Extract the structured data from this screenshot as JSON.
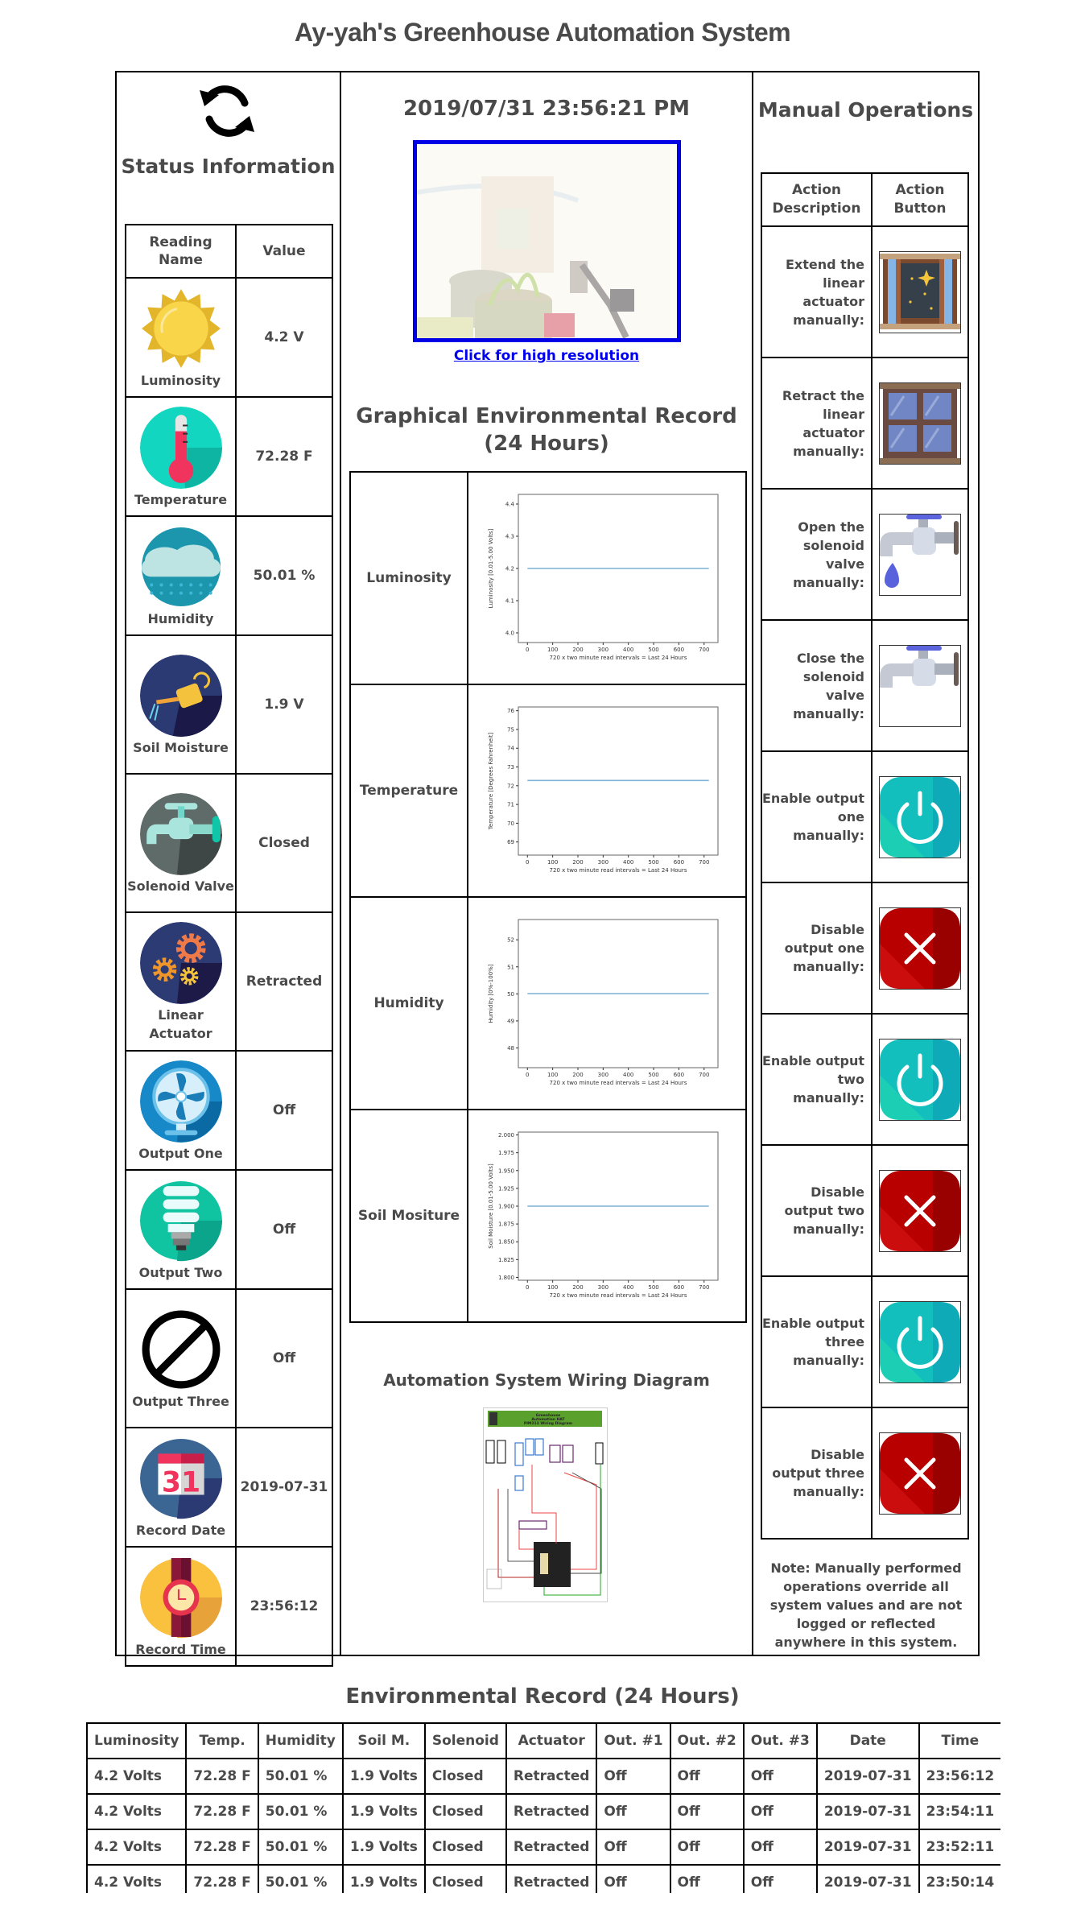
{
  "page": {
    "title": "Ay-yah's Greenhouse Automation System"
  },
  "status": {
    "heading": "Status Information",
    "refresh_icon": "refresh-icon",
    "columns": [
      "Reading Name",
      "Value"
    ],
    "rows": [
      {
        "label": "Luminosity",
        "value": "4.2 V",
        "icon": "sun-icon"
      },
      {
        "label": "Temperature",
        "value": "72.28 F",
        "icon": "thermometer-icon"
      },
      {
        "label": "Humidity",
        "value": "50.01 %",
        "icon": "rain-cloud-icon"
      },
      {
        "label": "Soil Moisture",
        "value": "1.9 V",
        "icon": "watering-can-icon"
      },
      {
        "label": "Solenoid Valve",
        "value": "Closed",
        "icon": "faucet-icon"
      },
      {
        "label": "Linear Actuator",
        "value": "Retracted",
        "icon": "gears-icon"
      },
      {
        "label": "Output One",
        "value": "Off",
        "icon": "fan-icon"
      },
      {
        "label": "Output Two",
        "value": "Off",
        "icon": "light-bulb-icon"
      },
      {
        "label": "Output Three",
        "value": "Off",
        "icon": "prohibited-icon"
      },
      {
        "label": "Record Date",
        "value": "2019-07-31",
        "icon": "calendar-icon"
      },
      {
        "label": "Record Time",
        "value": "23:56:12",
        "icon": "wristwatch-icon"
      }
    ]
  },
  "center": {
    "clock": "2019/07/31 23:56:21 PM",
    "camera_link": "Click for high resolution",
    "graph_heading": "Graphical Environmental Record (24 Hours)",
    "wiring_heading": "Automation System Wiring Diagram",
    "wiring_title_lines": [
      "Greenhouse",
      "Automation HAT",
      "PIM213 Wiring Diagram"
    ]
  },
  "chart_data": [
    {
      "type": "line",
      "row_label": "Luminosity",
      "ylabel": "Luminosity [0.01-5.00 Volts]",
      "xlabel": "720 x two minute read intervals = Last 24 Hours",
      "xlim": [
        -36,
        755
      ],
      "ylim": [
        3.97,
        4.43
      ],
      "xticks": [
        0,
        100,
        200,
        300,
        400,
        500,
        600,
        700
      ],
      "yticks": [
        "4.0",
        "4.1",
        "4.2",
        "4.3",
        "4.4"
      ],
      "x": [
        0,
        719
      ],
      "y": [
        4.2,
        4.2
      ]
    },
    {
      "type": "line",
      "row_label": "Temperature",
      "ylabel": "Temperature [Degrees Fahrenheit]",
      "xlabel": "720 x two minute read intervals = Last 24 Hours",
      "xlim": [
        -36,
        755
      ],
      "ylim": [
        68.3,
        76.2
      ],
      "xticks": [
        0,
        100,
        200,
        300,
        400,
        500,
        600,
        700
      ],
      "yticks": [
        "69",
        "70",
        "71",
        "72",
        "73",
        "74",
        "75",
        "76"
      ],
      "x": [
        0,
        719
      ],
      "y": [
        72.28,
        72.28
      ]
    },
    {
      "type": "line",
      "row_label": "Humidity",
      "ylabel": "Humidity [0%-100%]",
      "xlabel": "720 x two minute read intervals = Last 24 Hours",
      "xlim": [
        -36,
        755
      ],
      "ylim": [
        47.27,
        52.75
      ],
      "xticks": [
        0,
        100,
        200,
        300,
        400,
        500,
        600,
        700
      ],
      "yticks": [
        "48",
        "49",
        "50",
        "51",
        "52"
      ],
      "x": [
        0,
        719
      ],
      "y": [
        50.01,
        50.01
      ]
    },
    {
      "type": "line",
      "row_label": "Soil Mositure",
      "ylabel": "Soil Moisture [0.01-5.00 Volts]",
      "xlabel": "720 x two minute read intervals = Last 24 Hours",
      "xlim": [
        -36,
        755
      ],
      "ylim": [
        1.796,
        2.004
      ],
      "xticks": [
        0,
        100,
        200,
        300,
        400,
        500,
        600,
        700
      ],
      "yticks": [
        "1.800",
        "1.825",
        "1.850",
        "1.875",
        "1.900",
        "1.925",
        "1.950",
        "1.975",
        "2.000"
      ],
      "x": [
        0,
        719
      ],
      "y": [
        1.9,
        1.9
      ]
    }
  ],
  "manual": {
    "heading": "Manual Operations",
    "columns": [
      "Action Description",
      "Action Button"
    ],
    "actions": [
      {
        "label": "Extend the linear actuator manually:",
        "icon": "open-window-icon"
      },
      {
        "label": "Retract the linear actuator manually:",
        "icon": "closed-window-icon"
      },
      {
        "label": "Open the solenoid valve manually:",
        "icon": "faucet-dripping-icon"
      },
      {
        "label": "Close the solenoid valve manually:",
        "icon": "faucet-icon"
      },
      {
        "label": "Enable output one manually:",
        "icon": "power-on-icon"
      },
      {
        "label": "Disable output one manually:",
        "icon": "power-off-icon"
      },
      {
        "label": "Enable output two manually:",
        "icon": "power-on-icon"
      },
      {
        "label": "Disable output two manually:",
        "icon": "power-off-icon"
      },
      {
        "label": "Enable output three manually:",
        "icon": "power-on-icon"
      },
      {
        "label": "Disable output three manually:",
        "icon": "power-off-icon"
      }
    ],
    "note": "Note: Manually performed operations override all system values and are not logged or reflected anywhere in this system."
  },
  "record": {
    "heading": "Environmental Record (24 Hours)",
    "columns": [
      "Luminosity",
      "Temp.",
      "Humidity",
      "Soil M.",
      "Solenoid",
      "Actuator",
      "Out. #1",
      "Out. #2",
      "Out. #3",
      "Date",
      "Time"
    ],
    "rows": [
      [
        "4.2 Volts",
        "72.28 F",
        "50.01 %",
        "1.9 Volts",
        "Closed",
        "Retracted",
        "Off",
        "Off",
        "Off",
        "2019-07-31",
        "23:56:12"
      ],
      [
        "4.2 Volts",
        "72.28 F",
        "50.01 %",
        "1.9 Volts",
        "Closed",
        "Retracted",
        "Off",
        "Off",
        "Off",
        "2019-07-31",
        "23:54:11"
      ],
      [
        "4.2 Volts",
        "72.28 F",
        "50.01 %",
        "1.9 Volts",
        "Closed",
        "Retracted",
        "Off",
        "Off",
        "Off",
        "2019-07-31",
        "23:52:11"
      ],
      [
        "4.2 Volts",
        "72.28 F",
        "50.01 %",
        "1.9 Volts",
        "Closed",
        "Retracted",
        "Off",
        "Off",
        "Off",
        "2019-07-31",
        "23:50:14"
      ]
    ]
  },
  "colors": {
    "text": "#4a4a4a",
    "link": "#0000ee",
    "camera_border": "#0000e6",
    "plot_line": "#7fb2d5",
    "power_on": "#12bfbd",
    "power_off": "#b80000"
  }
}
